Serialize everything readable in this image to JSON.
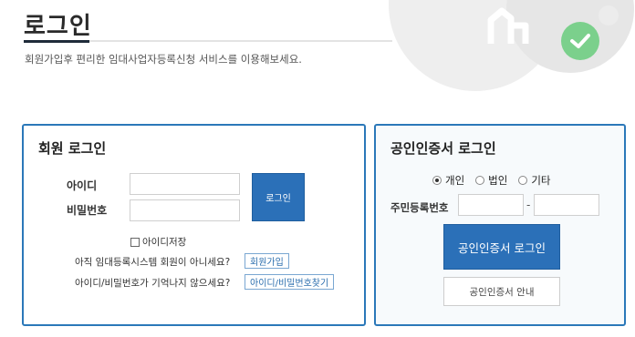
{
  "page": {
    "title": "로그인",
    "subtitle": "회원가입후 편리한 임대사업자등록신청 서비스를 이용해보세요."
  },
  "member_login": {
    "title": "회원 로그인",
    "id_label": "아이디",
    "password_label": "비밀번호",
    "id_value": "",
    "password_value": "",
    "login_button": "로그인",
    "save_id_label": "아이디저장",
    "no_account_text": "아직 임대등록시스템 회원이 아니세요?",
    "join_button": "회원가입",
    "forgot_text": "아이디/비밀번호가 기억나지 않으세요?",
    "find_button": "아이디/비밀번호찾기"
  },
  "cert_login": {
    "title": "공인인증서 로그인",
    "radio_options": [
      "개인",
      "법인",
      "기타"
    ],
    "selected": "개인",
    "rrn_label": "주민등록번호",
    "rrn_separator": "-",
    "rrn_front": "",
    "rrn_back": "",
    "login_button": "공인인증서 로그인",
    "guide_button": "공인인증서 안내"
  },
  "colors": {
    "accent": "#2b70b8",
    "panel_border": "#2b78b9",
    "check_badge": "#7bd08c"
  },
  "icons": {
    "check": "check-circle-icon",
    "radio": "radio-icon",
    "checkbox": "checkbox-icon"
  }
}
